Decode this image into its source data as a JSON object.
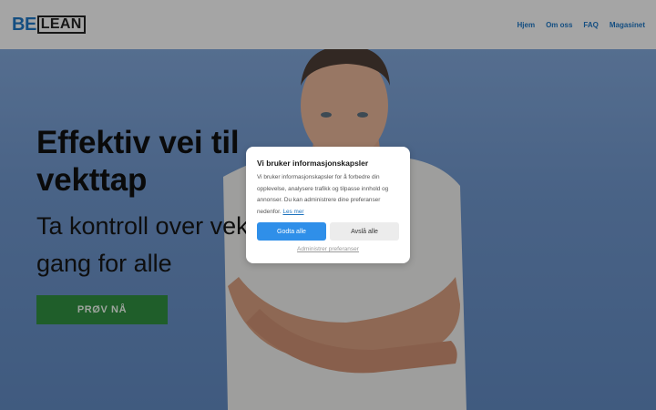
{
  "header": {
    "logo_be": "BE",
    "logo_lean": "LEAN",
    "nav": [
      "Hjem",
      "Om oss",
      "FAQ",
      "Magasinet"
    ]
  },
  "hero": {
    "title": "Effektiv vei til vekttap",
    "subtitle_line1": "Ta kontroll over vekten en",
    "subtitle_line2": "gang for alle",
    "cta_label": "PRØV NÅ"
  },
  "cookie_modal": {
    "title": "Vi bruker informasjonskapsler",
    "body": "Vi bruker informasjonskapsler for å forbedre din opplevelse, analysere trafikk og tilpasse innhold og annonser. Du kan administrere dine preferanser nedenfor.",
    "learn_more": "Les mer",
    "accept_label": "Godta alle",
    "decline_label": "Avslå alle",
    "manage_label": "Administrer preferanser"
  },
  "colors": {
    "brand_blue": "#1e73be",
    "cta_green": "#2e8b3e",
    "accept_blue": "#2f8fe9",
    "hero_bg": "#6c92c6"
  }
}
